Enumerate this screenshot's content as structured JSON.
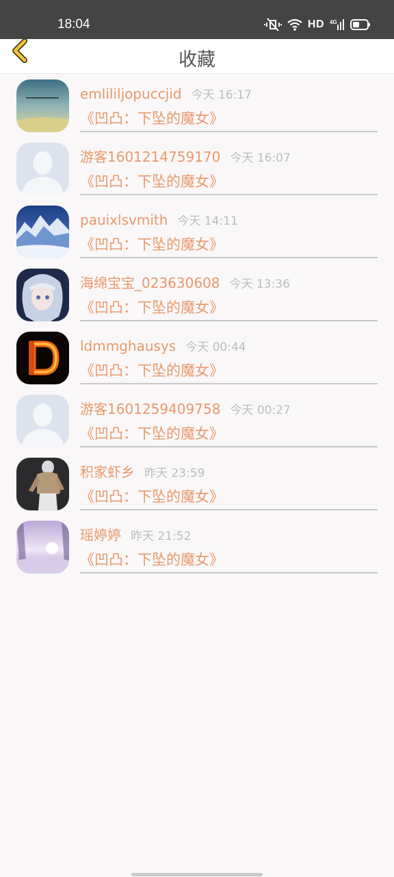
{
  "status_bar": {
    "time": "18:04",
    "hd_label": "HD",
    "network": "4G"
  },
  "header": {
    "title": "收藏"
  },
  "items": [
    {
      "username": "emlililjopuccjid",
      "time": "今天 16:17",
      "book": "《凹凸：下坠的魔女》",
      "avatar": "landscape-sky-photo"
    },
    {
      "username": "游客1601214759170",
      "time": "今天 16:07",
      "book": "《凹凸：下坠的魔女》",
      "avatar": "default-person"
    },
    {
      "username": "pauixlsvmith",
      "time": "今天 14:11",
      "book": "《凹凸：下坠的魔女》",
      "avatar": "snowy-mountain-photo"
    },
    {
      "username": "海绵宝宝_023630608",
      "time": "今天 13:36",
      "book": "《凹凸：下坠的魔女》",
      "avatar": "anime-girl-illustration"
    },
    {
      "username": "ldmmghausys",
      "time": "今天 00:44",
      "book": "《凹凸：下坠的魔女》",
      "avatar": "fire-letter-d"
    },
    {
      "username": "游客1601259409758",
      "time": "今天 00:27",
      "book": "《凹凸：下坠的魔女》",
      "avatar": "default-person"
    },
    {
      "username": "积家虾乡",
      "time": "昨天 23:59",
      "book": "《凹凸：下坠的魔女》",
      "avatar": "tattooed-man-illustration"
    },
    {
      "username": "瑶婷婷",
      "time": "昨天 21:52",
      "book": "《凹凸：下坠的魔女》",
      "avatar": "winter-forest-photo"
    }
  ],
  "colors": {
    "accent": "#e8996a",
    "time_gray": "#bdbdbd",
    "status_bar_bg": "#444444",
    "divider": "#c8c8c8",
    "back_icon": "#f2c53d"
  }
}
